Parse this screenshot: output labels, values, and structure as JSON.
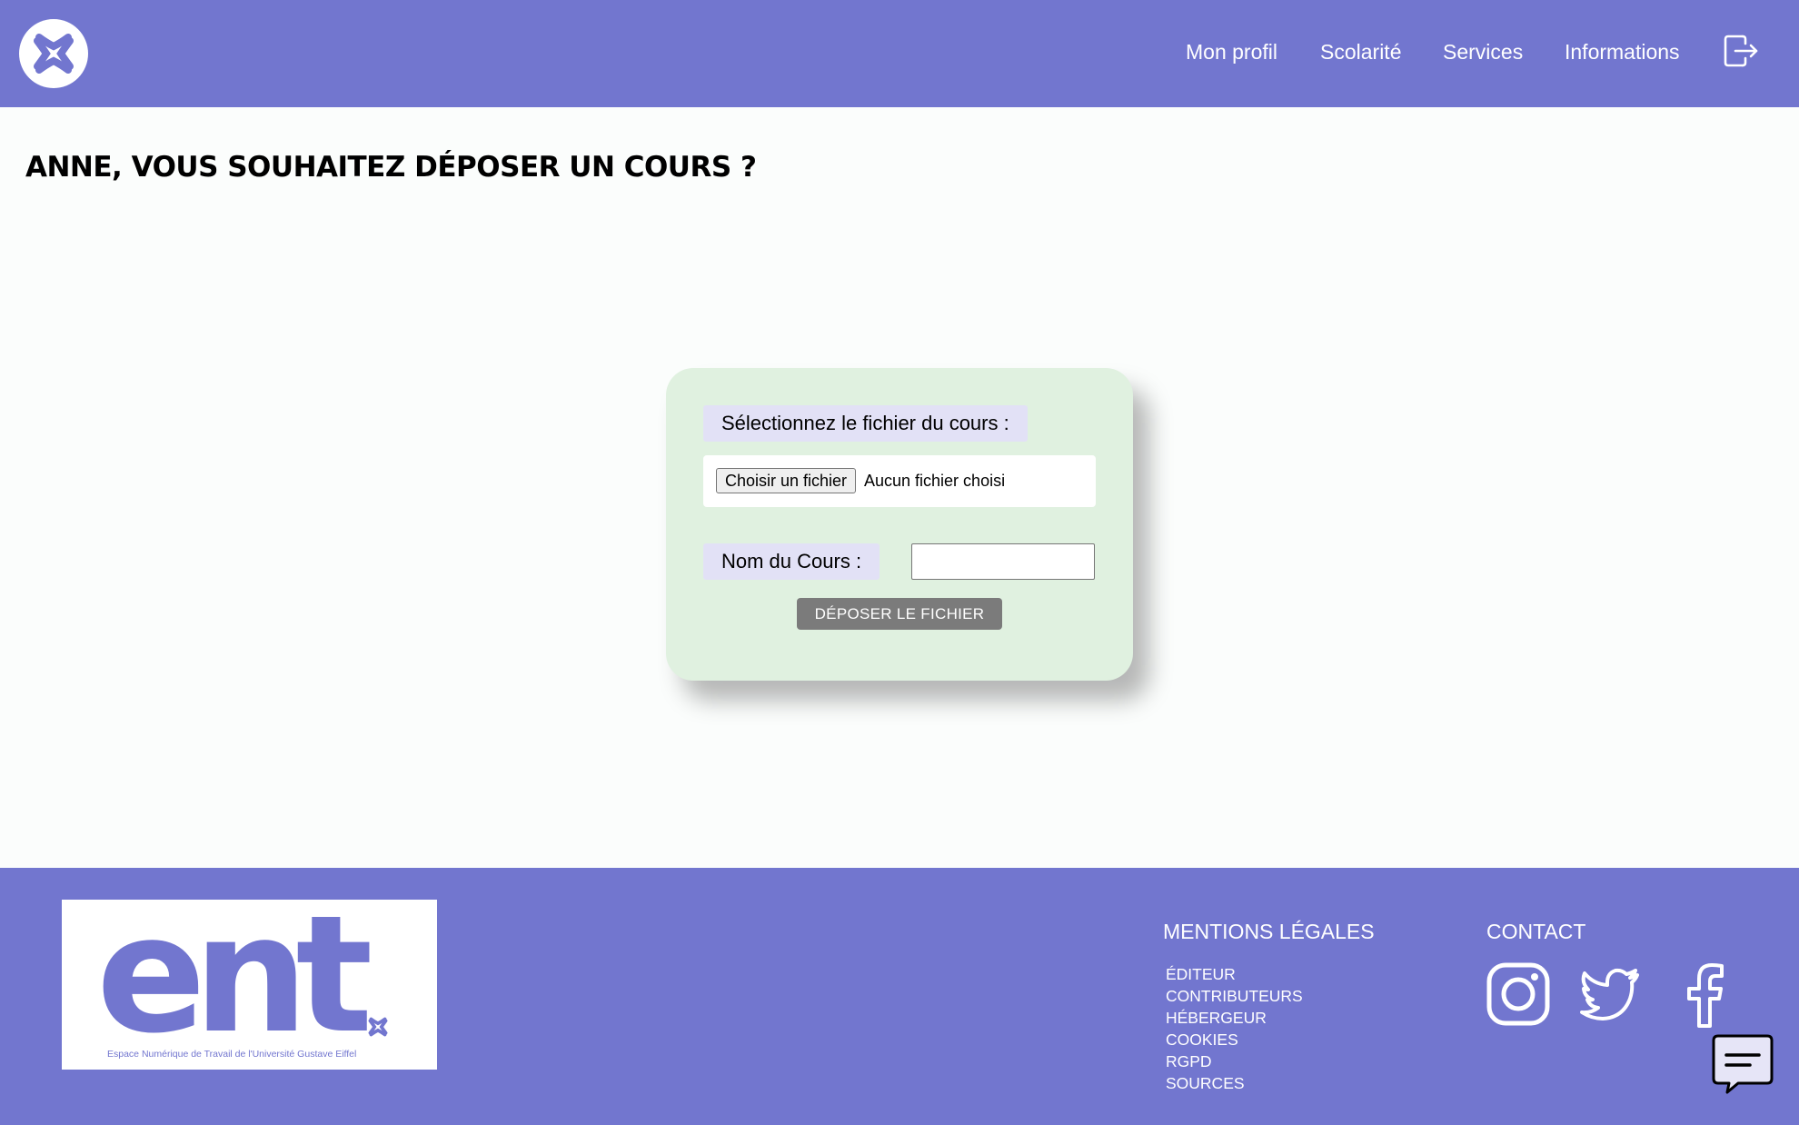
{
  "header": {
    "nav": [
      {
        "label": "Mon profil"
      },
      {
        "label": "Scolarité"
      },
      {
        "label": "Services"
      },
      {
        "label": "Informations"
      }
    ],
    "logout_icon": "logout-arrow-icon",
    "logo_icon": "angry-face-symbol-icon"
  },
  "main": {
    "title": "ANNE, VOUS SOUHAITEZ DÉPOSER UN COURS ?",
    "form": {
      "file_label": "Sélectionnez le fichier du cours :",
      "file_button": "Choisir un fichier",
      "file_status": "Aucun fichier choisi",
      "name_label": "Nom du Cours :",
      "name_value": "",
      "submit_label": "DÉPOSER LE FICHIER"
    }
  },
  "footer": {
    "logo_text": "ent",
    "logo_caption": "Espace Numérique de Travail de l'Université Gustave Eiffel",
    "legal_heading": "MENTIONS LÉGALES",
    "legal_items": [
      "ÉDITEUR",
      "CONTRIBUTEURS",
      "HÉBERGEUR",
      "COOKIES",
      "RGPD",
      "SOURCES"
    ],
    "contact_heading": "CONTACT",
    "social_icons": [
      "instagram-icon",
      "twitter-icon",
      "facebook-icon"
    ],
    "chat_icon": "chat-bubble-icon"
  },
  "colors": {
    "brand": "#7276cf",
    "card_bg": "#e0f1e0",
    "label_bg": "#e2e1f6",
    "submit_bg": "#7b7b7b"
  }
}
